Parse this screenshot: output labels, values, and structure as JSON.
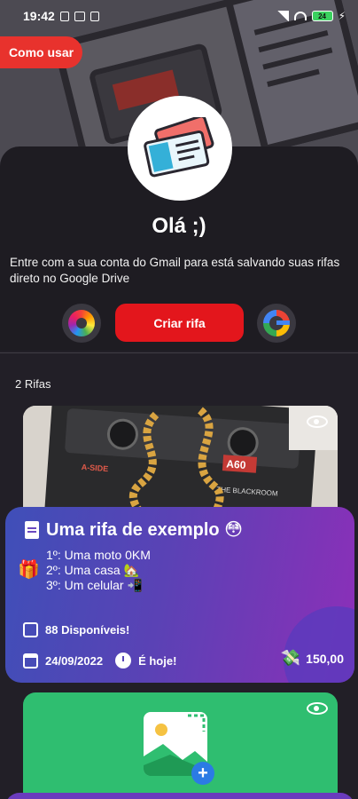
{
  "status_bar": {
    "time": "19:42",
    "battery": "24"
  },
  "header": {
    "how_to_use": "Como usar"
  },
  "profile": {
    "greeting": "Olá ;)",
    "subtitle": "Entre com a sua conta do Gmail para está salvando suas rifas direto no Google Drive",
    "create_button": "Criar rifa"
  },
  "raffles_count": "2 Rifas",
  "raffles": [
    {
      "title": "Uma rifa de exemplo 😳",
      "prizes": [
        "1º: Uma moto 0KM",
        "2º: Uma casa 🏡",
        "3º: Um celular 📲"
      ],
      "available": "88 Disponíveis!",
      "date": "24/09/2022",
      "status": "É hoje!",
      "price": "150,00"
    }
  ],
  "colors": {
    "accent_red": "#e3161c",
    "how_to_red": "#e8322d",
    "card_gradient_start": "#3f4fb8",
    "card_gradient_end": "#8c2fb8",
    "green_card": "#2fbe70"
  }
}
